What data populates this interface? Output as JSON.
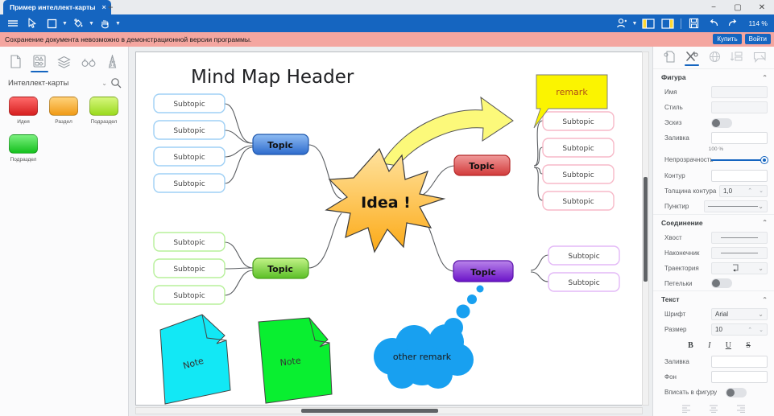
{
  "window": {
    "tab_title": "Пример интеллект-карты",
    "tab_close": "×",
    "new_tab": "+",
    "minimize": "−",
    "maximize": "▢",
    "close": "✕"
  },
  "toolbar": {
    "menu_icon": "hamburger-icon",
    "select_icon": "cursor-arrow-icon",
    "shape_icon": "rectangle-icon",
    "fill_icon": "paint-bucket-icon",
    "pan_icon": "hand-icon",
    "account_icon": "user-icon",
    "left_panel_icon": "left-panel-toggle-icon",
    "right_panel_icon": "right-panel-toggle-icon",
    "save_icon": "save-disk-icon",
    "undo_icon": "undo-icon",
    "redo_icon": "redo-icon",
    "zoom_level": "114 %"
  },
  "notice": {
    "message": "Сохранение документа невозможно в демонстрационной версии программы.",
    "buy_label": "Купить",
    "login_label": "Войти"
  },
  "left_panel": {
    "tabs": [
      {
        "name": "documents",
        "icon": "document-icon",
        "active": false
      },
      {
        "name": "shapes",
        "icon": "shapes-grid-icon",
        "active": true
      },
      {
        "name": "layers",
        "icon": "layers-icon",
        "active": false
      },
      {
        "name": "search-shapes",
        "icon": "binoculars-icon",
        "active": false
      },
      {
        "name": "charts",
        "icon": "chart-icon",
        "active": false
      }
    ],
    "library_label": "Интеллект-карты",
    "search_icon": "search-icon",
    "chevron_icon": "chevron-down-icon",
    "stencils": [
      {
        "label": "Идея",
        "color_top": "#ff5a5a",
        "color_bottom": "#d32020"
      },
      {
        "label": "Раздел",
        "color_top": "#ffc861",
        "color_bottom": "#f2a01b"
      },
      {
        "label": "Подраздел",
        "color_top": "#c9f05a",
        "color_bottom": "#96d81a"
      },
      {
        "label": "Подраздел",
        "color_top": "#66e86a",
        "color_bottom": "#18c020"
      }
    ]
  },
  "canvas": {
    "title": "Mind Map Header",
    "center_node": "Idea !",
    "callout_remark": "remark",
    "cloud_remark": "other remark",
    "topics": [
      {
        "id": "topic-blue",
        "label": "Topic",
        "color_top": "#7eb0ef",
        "color_bottom": "#2f6fd0",
        "border": "#1e57ad"
      },
      {
        "id": "topic-green",
        "label": "Topic",
        "color_top": "#b8ef7a",
        "color_bottom": "#5fc22a",
        "border": "#4aa21c"
      },
      {
        "id": "topic-red",
        "label": "Topic",
        "color_top": "#ef8d8d",
        "color_bottom": "#d43b3b",
        "border": "#b52a2a"
      },
      {
        "id": "topic-purple",
        "label": "Topic",
        "color_top": "#b07ae8",
        "color_bottom": "#6a15c9",
        "border": "#5a11aa"
      }
    ],
    "subtopics_blue": [
      "Subtopic",
      "Subtopic",
      "Subtopic",
      "Subtopic"
    ],
    "subtopics_green": [
      "Subtopic",
      "Subtopic",
      "Subtopic"
    ],
    "subtopics_red": [
      "Subtopic",
      "Subtopic",
      "Subtopic",
      "Subtopic"
    ],
    "subtopics_purple": [
      "Subtopic",
      "Subtopic"
    ],
    "notes": [
      {
        "label": "Note",
        "color": "#12e8f5"
      },
      {
        "label": "Note",
        "color": "#09ef30"
      }
    ],
    "arrow_color": "#fcf97a"
  },
  "right_panel": {
    "tabs": [
      {
        "name": "document-properties",
        "icon": "document-props-icon",
        "active": false
      },
      {
        "name": "shape-properties",
        "icon": "tools-icon",
        "active": true
      },
      {
        "name": "effects",
        "icon": "globe-icon",
        "active": false
      },
      {
        "name": "arrange",
        "icon": "align-icon",
        "active": false
      },
      {
        "name": "comments",
        "icon": "comment-icon",
        "active": false
      }
    ],
    "sections": {
      "figure": {
        "title": "Фигура",
        "name_label": "Имя",
        "name_value": "",
        "style_label": "Стиль",
        "style_value": "",
        "sketch_label": "Эскиз",
        "sketch_on": false,
        "fill_label": "Заливка",
        "fill_value": "",
        "opacity_label": "Непрозрачность",
        "opacity_value": "100 %",
        "outline_label": "Контур",
        "outline_value": "",
        "outline_width_label": "Толщина контура",
        "outline_width_value": "1,0",
        "dash_label": "Пунктир"
      },
      "connection": {
        "title": "Соединение",
        "tail_label": "Хвост",
        "arrowhead_label": "Наконечник",
        "trajectory_label": "Траектория",
        "loops_label": "Петельки",
        "loops_on": false
      },
      "text": {
        "title": "Текст",
        "font_label": "Шрифт",
        "font_value": "Arial",
        "size_label": "Размер",
        "size_value": "10",
        "bold": "B",
        "italic": "I",
        "underline": "U",
        "strike": "S",
        "fill_label": "Заливка",
        "fill_value": "",
        "background_label": "Фон",
        "background_value": "",
        "fit_label": "Вписать в фигуру",
        "fit_on": false
      }
    }
  },
  "colors": {
    "accent": "#1565c0",
    "notice_bg": "#f4a6a0"
  }
}
